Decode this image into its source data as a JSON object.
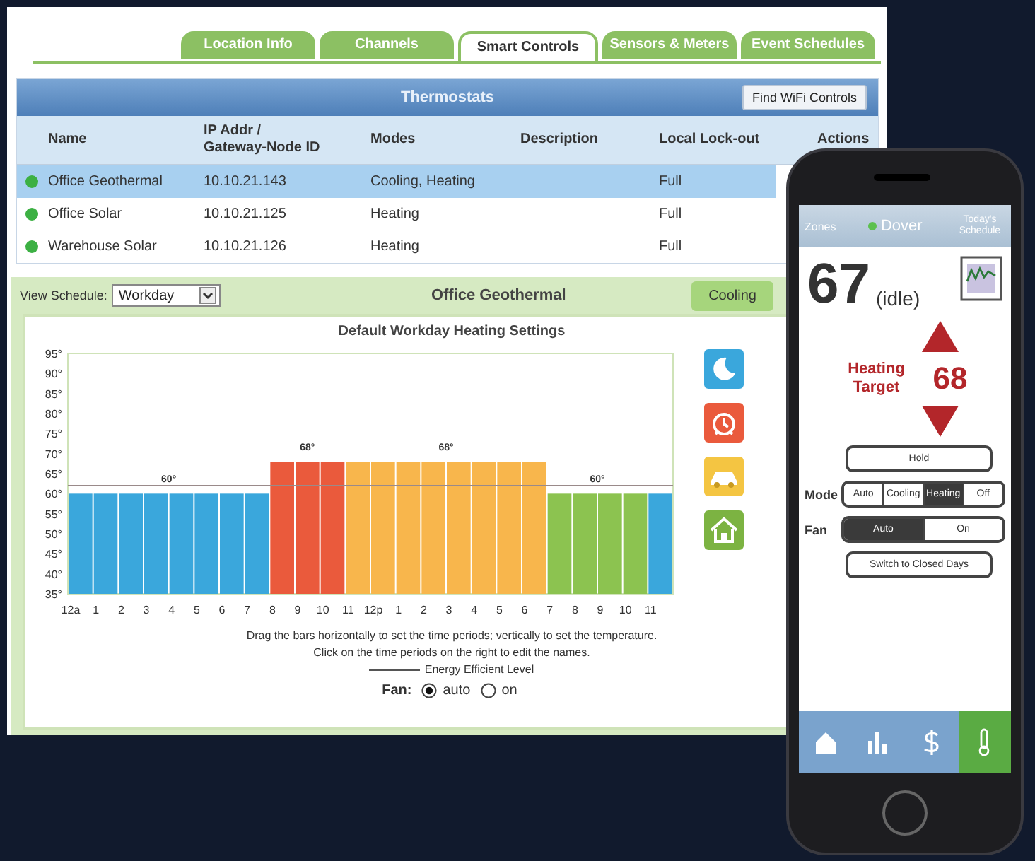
{
  "tabs": [
    {
      "label": "Location Info",
      "selected": false
    },
    {
      "label": "Channels",
      "selected": false
    },
    {
      "label": "Smart Controls",
      "selected": true
    },
    {
      "label": "Sensors & Meters",
      "selected": false
    },
    {
      "label": "Event Schedules",
      "selected": false
    }
  ],
  "thermostats": {
    "title": "Thermostats",
    "find_button": "Find WiFi Controls",
    "columns": [
      "Name",
      "IP Addr /\nGateway-Node ID",
      "Modes",
      "Description",
      "Local Lock-out",
      "Actions"
    ],
    "rows": [
      {
        "selected": true,
        "color": "#3cb043",
        "cells": [
          "Office Geothermal",
          "10.10.21.143",
          "Cooling, Heating",
          "",
          "Full"
        ]
      },
      {
        "selected": false,
        "color": "#3cb043",
        "cells": [
          "Office Solar",
          "10.10.21.125",
          "Heating",
          "",
          "Full"
        ]
      },
      {
        "selected": false,
        "color": "#3cb043",
        "cells": [
          "Warehouse Solar",
          "10.10.21.126",
          "Heating",
          "",
          "Full"
        ]
      }
    ]
  },
  "schedule": {
    "view_label": "View Schedule:",
    "view_value": "Workday",
    "title": "Office Geothermal",
    "mode_button": "Cooling",
    "chart_data": {
      "type": "bar",
      "title": "Default Workday Heating Settings",
      "categories": [
        "12a",
        "1",
        "2",
        "3",
        "4",
        "5",
        "6",
        "7",
        "8",
        "9",
        "10",
        "11",
        "12p",
        "1",
        "2",
        "3",
        "4",
        "5",
        "6",
        "7",
        "8",
        "9",
        "10",
        "11"
      ],
      "series": [
        {
          "color": "#3aa7dc",
          "values": [
            60,
            60,
            60,
            60,
            60,
            60,
            60,
            60,
            null,
            null,
            null,
            null,
            null,
            null,
            null,
            null,
            null,
            null,
            null,
            null,
            null,
            null,
            null,
            60
          ]
        },
        {
          "color": "#ea5a3c",
          "values": [
            null,
            null,
            null,
            null,
            null,
            null,
            null,
            null,
            68,
            68,
            68,
            null,
            null,
            null,
            null,
            null,
            null,
            null,
            null,
            null,
            null,
            null,
            null,
            null
          ]
        },
        {
          "color": "#f8b64c",
          "values": [
            null,
            null,
            null,
            null,
            null,
            null,
            null,
            null,
            null,
            null,
            null,
            68,
            68,
            68,
            68,
            68,
            68,
            68,
            68,
            null,
            null,
            null,
            null,
            null
          ]
        },
        {
          "color": "#8cc350",
          "values": [
            null,
            null,
            null,
            null,
            null,
            null,
            null,
            null,
            null,
            null,
            null,
            null,
            null,
            null,
            null,
            null,
            null,
            null,
            null,
            60,
            60,
            60,
            60,
            null
          ]
        }
      ],
      "ylim": [
        35,
        95
      ],
      "yticks": [
        {
          "value": 35,
          "label": "35°"
        },
        {
          "value": 40,
          "label": "40°"
        },
        {
          "value": 45,
          "label": "45°"
        },
        {
          "value": 50,
          "label": "50°"
        },
        {
          "value": 55,
          "label": "55°"
        },
        {
          "value": 60,
          "label": "60°"
        },
        {
          "value": 65,
          "label": "65°"
        },
        {
          "value": 70,
          "label": "70°"
        },
        {
          "value": 75,
          "label": "75°"
        },
        {
          "value": 80,
          "label": "80°"
        },
        {
          "value": 85,
          "label": "85°"
        },
        {
          "value": 90,
          "label": "90°"
        },
        {
          "value": 95,
          "label": "95°"
        }
      ],
      "annotations": [
        "60°",
        "68°",
        "68°",
        "60°"
      ],
      "ref_lines": [
        {
          "axis": "y",
          "value": 62,
          "label": "Energy Efficient Level"
        }
      ]
    },
    "period_icons": [
      {
        "kind": "moon",
        "color": "#3aa7dc"
      },
      {
        "kind": "alarm",
        "color": "#ea5a3c"
      },
      {
        "kind": "car",
        "color": "#f4c542"
      },
      {
        "kind": "home",
        "color": "#7cb342"
      }
    ],
    "instructions": [
      "Drag the bars horizontally to set the time periods; vertically to set the temperature.",
      "Click on the time periods on the right to edit the names."
    ],
    "fan_label": "Fan:",
    "fan_options": [
      {
        "label": "auto",
        "selected": true
      },
      {
        "label": "on",
        "selected": false
      }
    ]
  },
  "phone": {
    "back": "Zones",
    "zone": "Dover",
    "schedule_link": "Today's Schedule",
    "temperature": "67",
    "state": "(idle)",
    "target_label": "Heating Target",
    "target": "68",
    "hold": "Hold",
    "mode_label": "Mode",
    "modes": [
      {
        "label": "Auto",
        "selected": false
      },
      {
        "label": "Cooling",
        "selected": false
      },
      {
        "label": "Heating",
        "selected": true
      },
      {
        "label": "Off",
        "selected": false
      }
    ],
    "fan_label": "Fan",
    "fan_modes": [
      {
        "label": "Auto",
        "selected": true
      },
      {
        "label": "On",
        "selected": false
      }
    ],
    "switch_button": "Switch to Closed Days",
    "nav": [
      {
        "kind": "home",
        "selected": false
      },
      {
        "kind": "usage",
        "selected": false
      },
      {
        "kind": "costs",
        "selected": false
      },
      {
        "kind": "thermostat",
        "selected": true
      }
    ]
  }
}
